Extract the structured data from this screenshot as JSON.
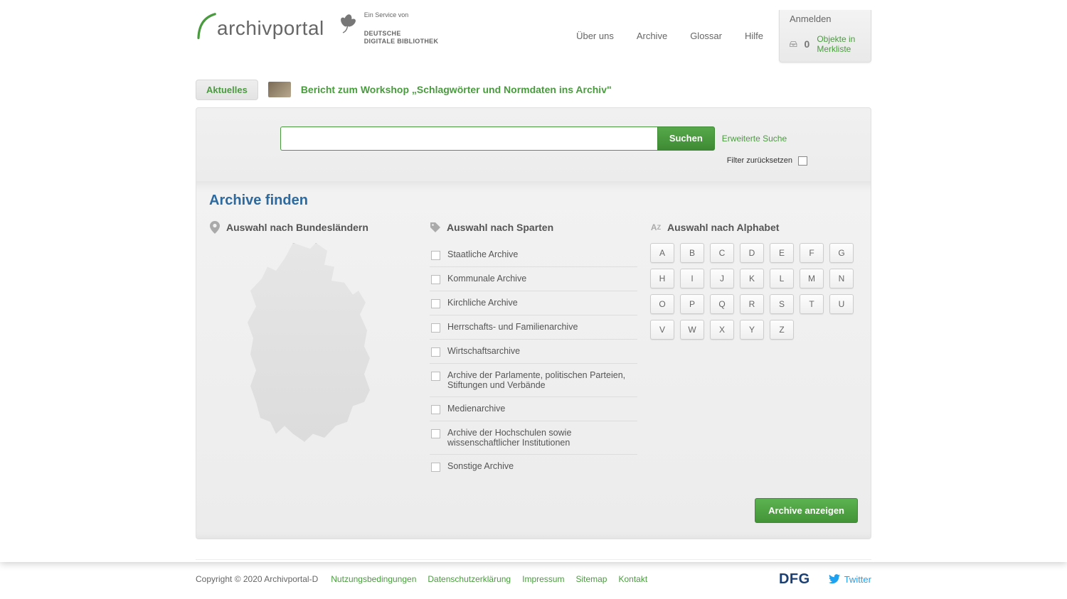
{
  "header": {
    "logo": "archivportal",
    "service_of": "Ein Service von",
    "brand1": "DEUTSCHE",
    "brand2": "DIGITALE BIBLIOTHEK"
  },
  "nav": [
    "Über uns",
    "Archive",
    "Glossar",
    "Hilfe"
  ],
  "login": {
    "label": "Anmelden",
    "count": "0",
    "watchlist": "Objekte in Merkliste"
  },
  "news": {
    "badge": "Aktuelles",
    "headline": "Bericht zum Workshop „Schlagwörter und Normdaten ins Archiv\""
  },
  "search": {
    "value": "",
    "button": "Suchen",
    "advanced": "Erweiterte Suche",
    "reset": "Filter zurücksetzen"
  },
  "finder": {
    "title": "Archive finden",
    "states_title": "Auswahl nach Bundesländern",
    "categories_title": "Auswahl nach Sparten",
    "alphabet_title": "Auswahl nach Alphabet",
    "categories": [
      "Staatliche Archive",
      "Kommunale Archive",
      "Kirchliche Archive",
      "Herrschafts- und Familienarchive",
      "Wirtschaftsarchive",
      "Archive der Parlamente, politischen Parteien, Stiftungen und Verbände",
      "Medienarchive",
      "Archive der Hochschulen sowie wissenschaftlicher Institutionen",
      "Sonstige Archive"
    ],
    "letters": [
      "A",
      "B",
      "C",
      "D",
      "E",
      "F",
      "G",
      "H",
      "I",
      "J",
      "K",
      "L",
      "M",
      "N",
      "O",
      "P",
      "Q",
      "R",
      "S",
      "T",
      "U",
      "V",
      "W",
      "X",
      "Y",
      "Z"
    ],
    "submit": "Archive anzeigen"
  },
  "footer": {
    "copyright": "Copyright © 2020 Archivportal-D",
    "links": [
      "Nutzungsbedingungen",
      "Datenschutzerklärung",
      "Impressum",
      "Sitemap",
      "Kontakt"
    ],
    "dfg": "DFG",
    "twitter": "Twitter"
  }
}
